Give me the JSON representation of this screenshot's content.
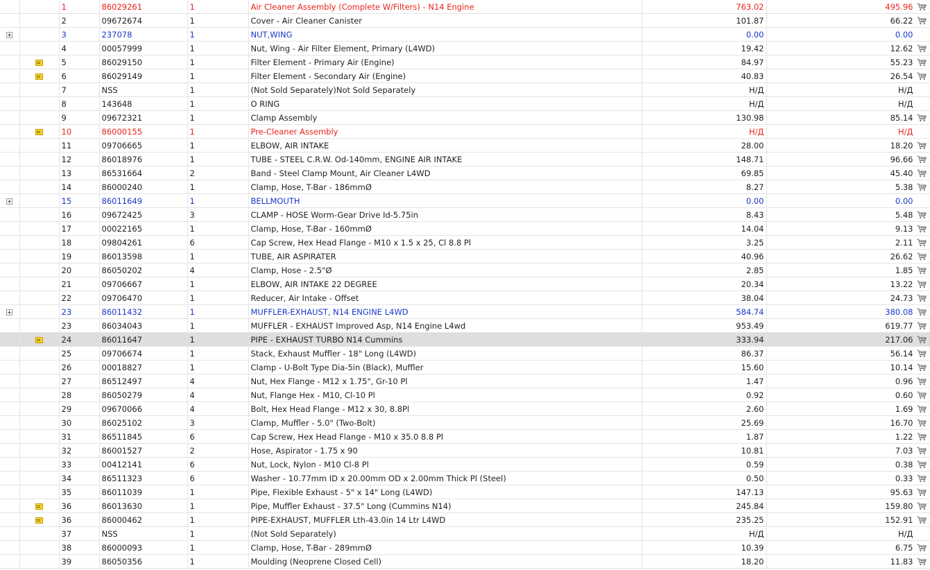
{
  "rows": [
    {
      "idx": "1",
      "part": "86029261",
      "qty": "1",
      "desc": "Air Cleaner Assembly (Complete W/Filters) - N14 Engine",
      "list": "763.02",
      "net": "495.96",
      "style": "red",
      "expand": false,
      "note": false,
      "cart": true,
      "selected": false
    },
    {
      "idx": "2",
      "part": "09672674",
      "qty": "1",
      "desc": "Cover - Air Cleaner Canister",
      "list": "101.87",
      "net": "66.22",
      "style": "",
      "expand": false,
      "note": false,
      "cart": true,
      "selected": false
    },
    {
      "idx": "3",
      "part": "237078",
      "qty": "1",
      "desc": "NUT,WING",
      "list": "0.00",
      "net": "0.00",
      "style": "blue",
      "expand": true,
      "note": false,
      "cart": false,
      "selected": false
    },
    {
      "idx": "4",
      "part": "00057999",
      "qty": "1",
      "desc": "Nut, Wing - Air Filter Element, Primary (L4WD)",
      "list": "19.42",
      "net": "12.62",
      "style": "",
      "expand": false,
      "note": false,
      "cart": true,
      "selected": false
    },
    {
      "idx": "5",
      "part": "86029150",
      "qty": "1",
      "desc": "Filter Element - Primary Air (Engine)",
      "list": "84.97",
      "net": "55.23",
      "style": "",
      "expand": false,
      "note": true,
      "cart": true,
      "selected": false
    },
    {
      "idx": "6",
      "part": "86029149",
      "qty": "1",
      "desc": "Filter Element - Secondary Air (Engine)",
      "list": "40.83",
      "net": "26.54",
      "style": "",
      "expand": false,
      "note": true,
      "cart": true,
      "selected": false
    },
    {
      "idx": "7",
      "part": "NSS",
      "qty": "1",
      "desc": "(Not Sold Separately)Not Sold Separately",
      "list": "Н/Д",
      "net": "Н/Д",
      "style": "",
      "expand": false,
      "note": false,
      "cart": false,
      "selected": false
    },
    {
      "idx": "8",
      "part": "143648",
      "qty": "1",
      "desc": "O RING",
      "list": "Н/Д",
      "net": "Н/Д",
      "style": "",
      "expand": false,
      "note": false,
      "cart": false,
      "selected": false
    },
    {
      "idx": "9",
      "part": "09672321",
      "qty": "1",
      "desc": "Clamp Assembly",
      "list": "130.98",
      "net": "85.14",
      "style": "",
      "expand": false,
      "note": false,
      "cart": true,
      "selected": false
    },
    {
      "idx": "10",
      "part": "86000155",
      "qty": "1",
      "desc": "Pre-Cleaner Assembly",
      "list": "Н/Д",
      "net": "Н/Д",
      "style": "red",
      "expand": false,
      "note": true,
      "cart": false,
      "selected": false
    },
    {
      "idx": "11",
      "part": "09706665",
      "qty": "1",
      "desc": "ELBOW, AIR INTAKE",
      "list": "28.00",
      "net": "18.20",
      "style": "",
      "expand": false,
      "note": false,
      "cart": true,
      "selected": false
    },
    {
      "idx": "12",
      "part": "86018976",
      "qty": "1",
      "desc": "TUBE - STEEL C.R.W. Od-140mm, ENGINE AIR INTAKE",
      "list": "148.71",
      "net": "96.66",
      "style": "",
      "expand": false,
      "note": false,
      "cart": true,
      "selected": false
    },
    {
      "idx": "13",
      "part": "86531664",
      "qty": "2",
      "desc": "Band - Steel Clamp Mount, Air Cleaner L4WD",
      "list": "69.85",
      "net": "45.40",
      "style": "",
      "expand": false,
      "note": false,
      "cart": true,
      "selected": false
    },
    {
      "idx": "14",
      "part": "86000240",
      "qty": "1",
      "desc": "Clamp, Hose, T-Bar - 186mmØ",
      "list": "8.27",
      "net": "5.38",
      "style": "",
      "expand": false,
      "note": false,
      "cart": true,
      "selected": false
    },
    {
      "idx": "15",
      "part": "86011649",
      "qty": "1",
      "desc": "BELLMOUTH",
      "list": "0.00",
      "net": "0.00",
      "style": "blue",
      "expand": true,
      "note": false,
      "cart": false,
      "selected": false
    },
    {
      "idx": "16",
      "part": "09672425",
      "qty": "3",
      "desc": "CLAMP - HOSE Worm-Gear Drive Id-5.75in",
      "list": "8.43",
      "net": "5.48",
      "style": "",
      "expand": false,
      "note": false,
      "cart": true,
      "selected": false
    },
    {
      "idx": "17",
      "part": "00022165",
      "qty": "1",
      "desc": "Clamp, Hose, T-Bar - 160mmØ",
      "list": "14.04",
      "net": "9.13",
      "style": "",
      "expand": false,
      "note": false,
      "cart": true,
      "selected": false
    },
    {
      "idx": "18",
      "part": "09804261",
      "qty": "6",
      "desc": "Cap Screw, Hex Head Flange - M10 x 1.5 x 25, Cl 8.8 Pl",
      "list": "3.25",
      "net": "2.11",
      "style": "",
      "expand": false,
      "note": false,
      "cart": true,
      "selected": false
    },
    {
      "idx": "19",
      "part": "86013598",
      "qty": "1",
      "desc": "TUBE, AIR ASPIRATER",
      "list": "40.96",
      "net": "26.62",
      "style": "",
      "expand": false,
      "note": false,
      "cart": true,
      "selected": false
    },
    {
      "idx": "20",
      "part": "86050202",
      "qty": "4",
      "desc": "Clamp, Hose - 2.5\"Ø",
      "list": "2.85",
      "net": "1.85",
      "style": "",
      "expand": false,
      "note": false,
      "cart": true,
      "selected": false
    },
    {
      "idx": "21",
      "part": "09706667",
      "qty": "1",
      "desc": "ELBOW, AIR INTAKE 22 DEGREE",
      "list": "20.34",
      "net": "13.22",
      "style": "",
      "expand": false,
      "note": false,
      "cart": true,
      "selected": false
    },
    {
      "idx": "22",
      "part": "09706470",
      "qty": "1",
      "desc": "Reducer, Air Intake - Offset",
      "list": "38.04",
      "net": "24.73",
      "style": "",
      "expand": false,
      "note": false,
      "cart": true,
      "selected": false
    },
    {
      "idx": "23",
      "part": "86011432",
      "qty": "1",
      "desc": "MUFFLER-EXHAUST, N14 ENGINE L4WD",
      "list": "584.74",
      "net": "380.08",
      "style": "blue",
      "expand": true,
      "note": false,
      "cart": true,
      "selected": false
    },
    {
      "idx": "23",
      "part": "86034043",
      "qty": "1",
      "desc": "MUFFLER - EXHAUST Improved Asp, N14 Engine L4wd",
      "list": "953.49",
      "net": "619.77",
      "style": "",
      "expand": false,
      "note": false,
      "cart": true,
      "selected": false
    },
    {
      "idx": "24",
      "part": "86011647",
      "qty": "1",
      "desc": "PIPE - EXHAUST TURBO N14 Cummins",
      "list": "333.94",
      "net": "217.06",
      "style": "",
      "expand": false,
      "note": true,
      "cart": true,
      "selected": true
    },
    {
      "idx": "25",
      "part": "09706674",
      "qty": "1",
      "desc": "Stack, Exhaust Muffler - 18\" Long (L4WD)",
      "list": "86.37",
      "net": "56.14",
      "style": "",
      "expand": false,
      "note": false,
      "cart": true,
      "selected": false
    },
    {
      "idx": "26",
      "part": "00018827",
      "qty": "1",
      "desc": "Clamp - U-Bolt Type Dia-5in (Black), Muffler",
      "list": "15.60",
      "net": "10.14",
      "style": "",
      "expand": false,
      "note": false,
      "cart": true,
      "selected": false
    },
    {
      "idx": "27",
      "part": "86512497",
      "qty": "4",
      "desc": "Nut, Hex Flange - M12 x 1.75\", Gr-10 Pl",
      "list": "1.47",
      "net": "0.96",
      "style": "",
      "expand": false,
      "note": false,
      "cart": true,
      "selected": false
    },
    {
      "idx": "28",
      "part": "86050279",
      "qty": "4",
      "desc": "Nut, Flange Hex - M10, Cl-10 Pl",
      "list": "0.92",
      "net": "0.60",
      "style": "",
      "expand": false,
      "note": false,
      "cart": true,
      "selected": false
    },
    {
      "idx": "29",
      "part": "09670066",
      "qty": "4",
      "desc": "Bolt, Hex Head Flange - M12 x 30, 8.8Pl",
      "list": "2.60",
      "net": "1.69",
      "style": "",
      "expand": false,
      "note": false,
      "cart": true,
      "selected": false
    },
    {
      "idx": "30",
      "part": "86025102",
      "qty": "3",
      "desc": "Clamp, Muffler - 5.0\" (Two-Bolt)",
      "list": "25.69",
      "net": "16.70",
      "style": "",
      "expand": false,
      "note": false,
      "cart": true,
      "selected": false
    },
    {
      "idx": "31",
      "part": "86511845",
      "qty": "6",
      "desc": "Cap Screw, Hex Head Flange - M10 x 35.0 8.8 Pl",
      "list": "1.87",
      "net": "1.22",
      "style": "",
      "expand": false,
      "note": false,
      "cart": true,
      "selected": false
    },
    {
      "idx": "32",
      "part": "86001527",
      "qty": "2",
      "desc": "Hose, Aspirator - 1.75 x 90",
      "list": "10.81",
      "net": "7.03",
      "style": "",
      "expand": false,
      "note": false,
      "cart": true,
      "selected": false
    },
    {
      "idx": "33",
      "part": "00412141",
      "qty": "6",
      "desc": "Nut, Lock, Nylon - M10 Cl-8 Pl",
      "list": "0.59",
      "net": "0.38",
      "style": "",
      "expand": false,
      "note": false,
      "cart": true,
      "selected": false
    },
    {
      "idx": "34",
      "part": "86511323",
      "qty": "6",
      "desc": "Washer - 10.77mm ID x 20.00mm OD x 2.00mm Thick Pl (Steel)",
      "list": "0.50",
      "net": "0.33",
      "style": "",
      "expand": false,
      "note": false,
      "cart": true,
      "selected": false
    },
    {
      "idx": "35",
      "part": "86011039",
      "qty": "1",
      "desc": "Pipe, Flexible Exhaust - 5\" x 14\" Long (L4WD)",
      "list": "147.13",
      "net": "95.63",
      "style": "",
      "expand": false,
      "note": false,
      "cart": true,
      "selected": false
    },
    {
      "idx": "36",
      "part": "86013630",
      "qty": "1",
      "desc": "Pipe, Muffler Exhaust - 37.5\" Long (Cummins N14)",
      "list": "245.84",
      "net": "159.80",
      "style": "",
      "expand": false,
      "note": true,
      "cart": true,
      "selected": false
    },
    {
      "idx": "36",
      "part": "86000462",
      "qty": "1",
      "desc": "PIPE-EXHAUST, MUFFLER Lth-43.0in 14 Ltr L4WD",
      "list": "235.25",
      "net": "152.91",
      "style": "",
      "expand": false,
      "note": true,
      "cart": true,
      "selected": false
    },
    {
      "idx": "37",
      "part": "NSS",
      "qty": "1",
      "desc": "(Not Sold Separately)",
      "list": "Н/Д",
      "net": "Н/Д",
      "style": "",
      "expand": false,
      "note": false,
      "cart": false,
      "selected": false
    },
    {
      "idx": "38",
      "part": "86000093",
      "qty": "1",
      "desc": "Clamp, Hose, T-Bar - 289mmØ",
      "list": "10.39",
      "net": "6.75",
      "style": "",
      "expand": false,
      "note": false,
      "cart": true,
      "selected": false
    },
    {
      "idx": "39",
      "part": "86050356",
      "qty": "1",
      "desc": "Moulding (Neoprene Closed Cell)",
      "list": "18.20",
      "net": "11.83",
      "style": "",
      "expand": false,
      "note": false,
      "cart": true,
      "selected": false
    }
  ],
  "icons": {
    "expand": "plus-box-icon",
    "note": "note-icon",
    "cart": "shopping-cart-icon"
  },
  "colors": {
    "red": "#e8221a",
    "blue": "#1a37c8",
    "selected_row": "#dedede",
    "grid": "#e4e4e4"
  }
}
